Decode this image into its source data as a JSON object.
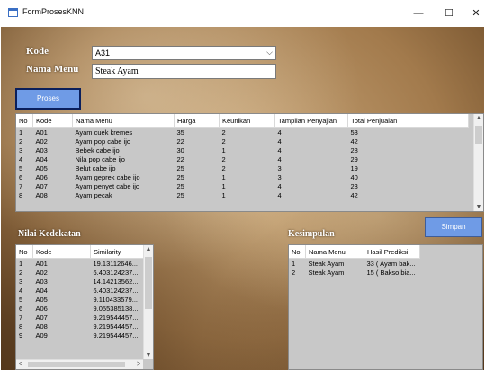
{
  "window": {
    "title": "FormProsesKNN",
    "minimize": "—",
    "maximize": "☐",
    "close": "✕"
  },
  "form": {
    "kode_label": "Kode",
    "kode_value": "A31",
    "nama_label": "Nama Menu",
    "nama_value": "Steak Ayam",
    "proses_button": "Proses",
    "simpan_button": "Simpan"
  },
  "data_grid": {
    "columns": [
      "No",
      "Kode",
      "Nama Menu",
      "Harga",
      "Keunikan",
      "Tampilan Penyajian",
      "Total Penjualan"
    ],
    "rows": [
      [
        "1",
        "A01",
        "Ayam cuek kremes",
        "35",
        "2",
        "4",
        "53"
      ],
      [
        "2",
        "A02",
        "Ayam pop cabe ijo",
        "22",
        "2",
        "4",
        "42"
      ],
      [
        "3",
        "A03",
        "Bebek cabe ijo",
        "30",
        "1",
        "4",
        "28"
      ],
      [
        "4",
        "A04",
        "Nila pop cabe ijo",
        "22",
        "2",
        "4",
        "29"
      ],
      [
        "5",
        "A05",
        "Belut cabe ijo",
        "25",
        "2",
        "3",
        "19"
      ],
      [
        "6",
        "A06",
        "Ayam geprek cabe ijo",
        "25",
        "1",
        "3",
        "40"
      ],
      [
        "7",
        "A07",
        "Ayam penyet cabe ijo",
        "25",
        "1",
        "4",
        "23"
      ],
      [
        "8",
        "A08",
        "Ayam pecak",
        "25",
        "1",
        "4",
        "42"
      ]
    ]
  },
  "nilai": {
    "label": "Nilai Kedekatan",
    "columns": [
      "No",
      "Kode",
      "Similarity"
    ],
    "rows": [
      [
        "1",
        "A01",
        "19.13112646..."
      ],
      [
        "2",
        "A02",
        "6.403124237..."
      ],
      [
        "3",
        "A03",
        "14.14213562..."
      ],
      [
        "4",
        "A04",
        "6.403124237..."
      ],
      [
        "5",
        "A05",
        "9.110433579..."
      ],
      [
        "6",
        "A06",
        "9.055385138..."
      ],
      [
        "7",
        "A07",
        "9.219544457..."
      ],
      [
        "8",
        "A08",
        "9.219544457..."
      ],
      [
        "9",
        "A09",
        "9.219544457..."
      ]
    ]
  },
  "kesimpulan": {
    "label": "Kesimpulan",
    "columns": [
      "No",
      "Nama Menu",
      "Hasil Prediksi"
    ],
    "rows": [
      [
        "1",
        "Steak Ayam",
        "33 ( Ayam bak..."
      ],
      [
        "2",
        "Steak Ayam",
        "15 ( Bakso bia..."
      ]
    ]
  },
  "icons": {
    "app": "form-icon",
    "scroll_up": "▲",
    "scroll_down": "▼",
    "scroll_left": "<",
    "scroll_right": ">"
  }
}
